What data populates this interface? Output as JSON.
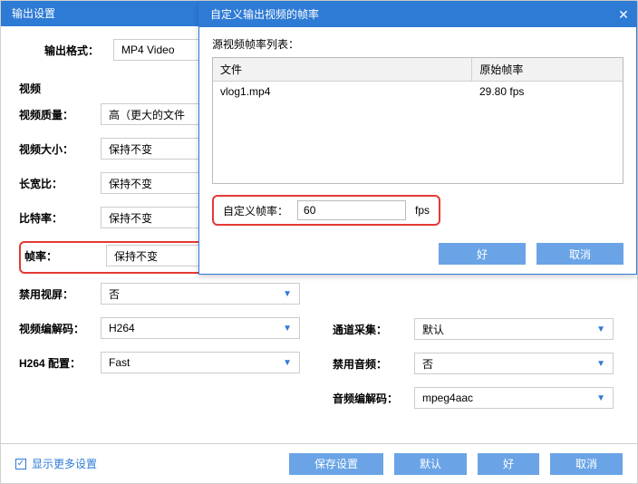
{
  "main": {
    "title": "输出设置",
    "outputFormatLabel": "输出格式：",
    "outputFormatValue": "MP4 Video"
  },
  "video": {
    "header": "视频",
    "qualityLabel": "视频质量：",
    "qualityValue": "高（更大的文件",
    "sizeLabel": "视频大小：",
    "sizeValue": "保持不变",
    "aspectLabel": "长宽比：",
    "aspectValue": "保持不变",
    "bitrateLabel": "比特率：",
    "bitrateValue": "保持不变",
    "fpsLabel": "帧率：",
    "fpsValue": "保持不变",
    "disableLabel": "禁用视屏：",
    "disableValue": "否",
    "codecLabel": "视频编解码：",
    "codecValue": "H264",
    "h264Label": "H264 配置：",
    "h264Value": "Fast"
  },
  "audio": {
    "channelLabel": "通道采集：",
    "channelValue": "默认",
    "disableLabel": "禁用音频：",
    "disableValue": "否",
    "codecLabel": "音频编解码：",
    "codecValue": "mpeg4aac"
  },
  "bottom": {
    "showMore": "显示更多设置",
    "save": "保存设置",
    "default": "默认",
    "ok": "好",
    "cancel": "取消"
  },
  "dialog": {
    "title": "自定义输出视频的帧率",
    "listLabel": "源视频帧率列表：",
    "colFile": "文件",
    "colFps": "原始帧率",
    "rowFile": "vlog1.mp4",
    "rowFps": "29.80 fps",
    "customLabel": "自定义帧率：",
    "customValue": "60",
    "unit": "fps",
    "ok": "好",
    "cancel": "取消"
  }
}
